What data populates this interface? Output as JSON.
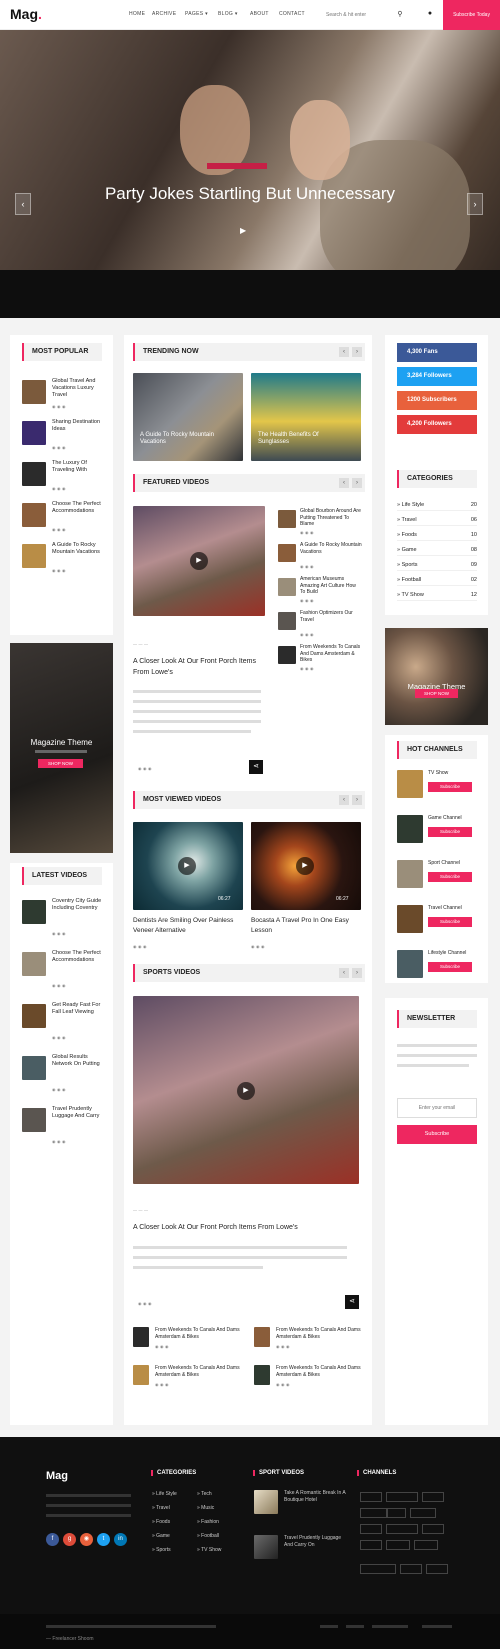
{
  "header": {
    "logo": "Mag",
    "logo_dot": ".",
    "nav": [
      "HOME",
      "ARCHIVE",
      "PAGES",
      "BLOG",
      "ABOUT",
      "CONTACT"
    ],
    "nav_dd": "▾",
    "search_placeholder": "Search & hit enter",
    "search_icon": "search-icon",
    "user_icon": "user-icon",
    "subscribe": "Subscribe Today"
  },
  "hero": {
    "title": "Party Jokes Startling But Unnecessary",
    "prev": "‹",
    "next": "›",
    "play": "▶"
  },
  "popular": {
    "title": "MOST POPULAR",
    "items": [
      {
        "title": "Global Travel And Vacations Luxury Travel"
      },
      {
        "title": "Sharing Destination Ideas"
      },
      {
        "title": "The Luxury Of Traveling With"
      },
      {
        "title": "Choose The Perfect Accommodations"
      },
      {
        "title": "A Guide To Rocky Mountain Vacations"
      }
    ]
  },
  "promo": {
    "title": "Magazine Theme",
    "btn": "SHOP NOW"
  },
  "latest": {
    "title": "LATEST VIDEOS",
    "items": [
      {
        "title": "Coventry City Guide Including Coventry"
      },
      {
        "title": "Choose The Perfect Accommodations"
      },
      {
        "title": "Get Ready Fast For Fall Leaf Viewing"
      },
      {
        "title": "Global Results Network On Putting"
      },
      {
        "title": "Travel Prudently Luggage And Carry"
      }
    ]
  },
  "trending": {
    "title": "TRENDING NOW",
    "prev": "‹",
    "next": "›",
    "cards": [
      {
        "title": "A Guide To Rocky Mountain Vacations"
      },
      {
        "title": "The Health Benefits Of Sunglasses"
      }
    ]
  },
  "featured": {
    "title": "FEATURED VIDEOS",
    "main_title": "A Closer Look At Our Front Porch Items From Lowe's",
    "side": [
      "Global Bourbon Around Are Putting Threatened To Blame",
      "A Guide To Rocky Mountain Vacations",
      "American Museums Amazing Art Culture How To Build",
      "Fashion Optimizers Our Travel",
      "From Weekends To Canals And Dams Amsterdam & Bikes"
    ]
  },
  "mostviewed": {
    "title": "MOST VIEWED VIDEOS",
    "cards": [
      {
        "title": "Dentists Are Smiling Over Painless Veneer Alternative",
        "dur": "06:27"
      },
      {
        "title": "Bocasta A Travel Pro In One Easy Lesson",
        "dur": "06:27"
      }
    ]
  },
  "sports": {
    "title": "SPORTS VIDEOS",
    "main_title": "A Closer Look At Our Front Porch Items From Lowe's",
    "grid": [
      "From Weekends To Canals And Dams Amsterdam & Bikes",
      "From Weekends To Canals And Dams Amsterdam & Bikes",
      "From Weekends To Canals And Dams Amsterdam & Bikes",
      "From Weekends To Canals And Dams Amsterdam & Bikes"
    ]
  },
  "social": [
    {
      "label": "4,300 Fans",
      "color": "#3b5998"
    },
    {
      "label": "3,284 Followers",
      "color": "#1da1f2"
    },
    {
      "label": "1200 Subscribers",
      "color": "#e8613c"
    },
    {
      "label": "4,200 Followers",
      "color": "#e33b3b"
    }
  ],
  "categories": {
    "title": "CATEGORIES",
    "items": [
      {
        "name": "Life Style",
        "count": "20"
      },
      {
        "name": "Travel",
        "count": "06"
      },
      {
        "name": "Foods",
        "count": "10"
      },
      {
        "name": "Game",
        "count": "08"
      },
      {
        "name": "Sports",
        "count": "09"
      },
      {
        "name": "Football",
        "count": "02"
      },
      {
        "name": "TV Show",
        "count": "12"
      }
    ]
  },
  "promo2": {
    "title": "Magazine Theme",
    "btn": "SHOP NOW"
  },
  "channels": {
    "title": "HOT CHANNELS",
    "sub": "Subscribe",
    "items": [
      "TV Show",
      "Game Channel",
      "Sport Channel",
      "Travel Channel",
      "Lifestyle Channel"
    ]
  },
  "newsletter": {
    "title": "NEWSLETTER",
    "placeholder": "Enter your email",
    "btn": "Subscribe"
  },
  "footer": {
    "logo": "Mag",
    "cat_title": "CATEGORIES",
    "cats": [
      "Life Style",
      "Travel",
      "Foods",
      "Game",
      "Sports",
      "Tech",
      "Music",
      "Fashion",
      "Football",
      "TV Show"
    ],
    "vid_title": "SPORT VIDEOS",
    "vids": [
      "Take A Romantic Break In A Boutique Hotel",
      "Travel Prudently Luggage And Carry On"
    ],
    "chan_title": "CHANNELS",
    "copy": "Freelancer Shoom"
  }
}
